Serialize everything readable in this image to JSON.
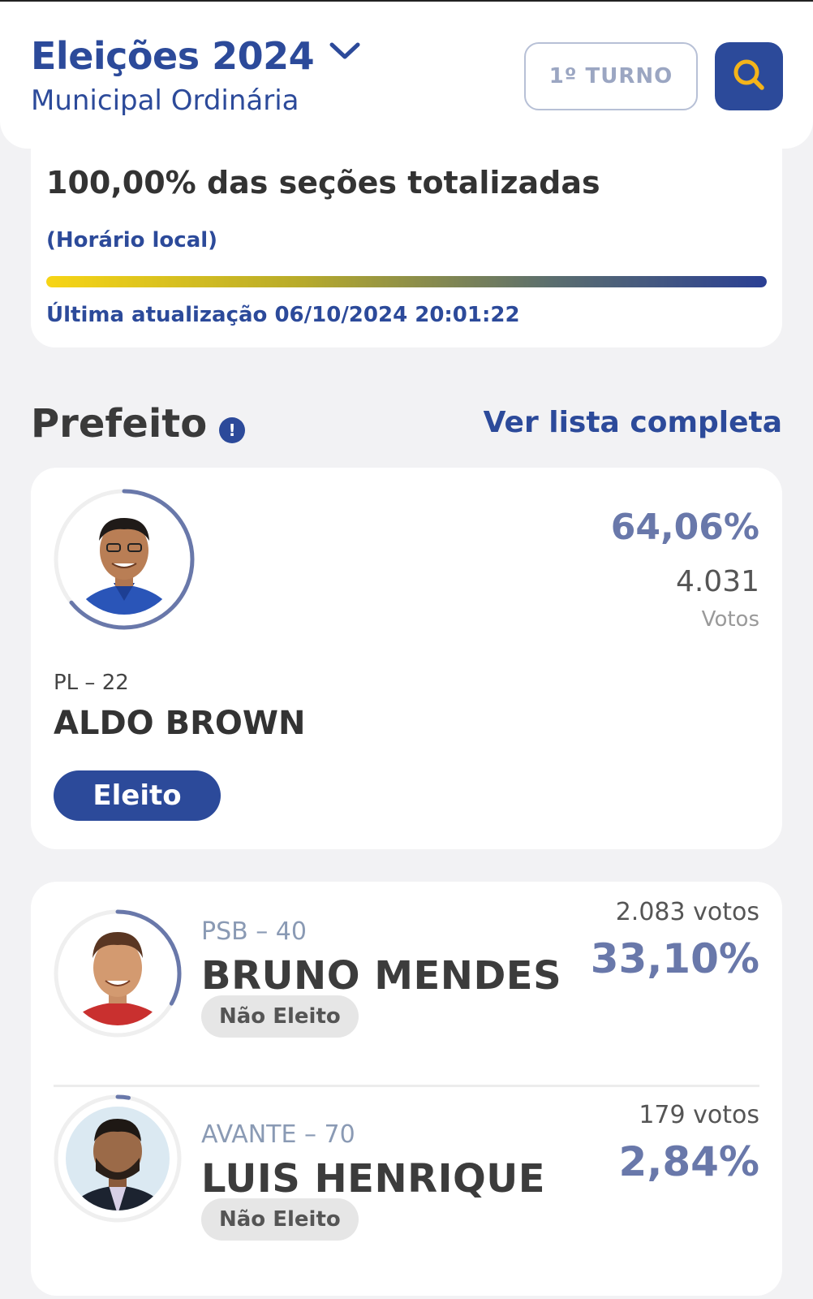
{
  "header": {
    "title": "Eleições 2024",
    "subtitle": "Municipal Ordinária",
    "turno_label": "1º TURNO"
  },
  "progress": {
    "title": "100,00% das seções totalizadas",
    "local_time_label": "(Horário local)",
    "percent": 100,
    "last_update": "Última atualização 06/10/2024 20:01:22"
  },
  "section": {
    "title": "Prefeito",
    "info_icon": "!",
    "see_full_list": "Ver lista completa"
  },
  "winner": {
    "percent": "64,06%",
    "votes": "4.031",
    "votes_label": "Votos",
    "party": "PL – 22",
    "name": "ALDO BROWN",
    "status": "Eleito",
    "ring_fraction": 0.6406
  },
  "candidates": [
    {
      "party": "PSB – 40",
      "name": "BRUNO MENDES",
      "status": "Não Eleito",
      "votes": "2.083 votos",
      "percent": "33,10%",
      "ring_fraction": 0.331
    },
    {
      "party": "AVANTE – 70",
      "name": "LUIS HENRIQUE",
      "status": "Não Eleito",
      "votes": "179 votos",
      "percent": "2,84%",
      "ring_fraction": 0.0284
    }
  ],
  "colors": {
    "primary": "#2c4a9a",
    "percent_text": "#6978aa",
    "background": "#f2f2f4"
  }
}
